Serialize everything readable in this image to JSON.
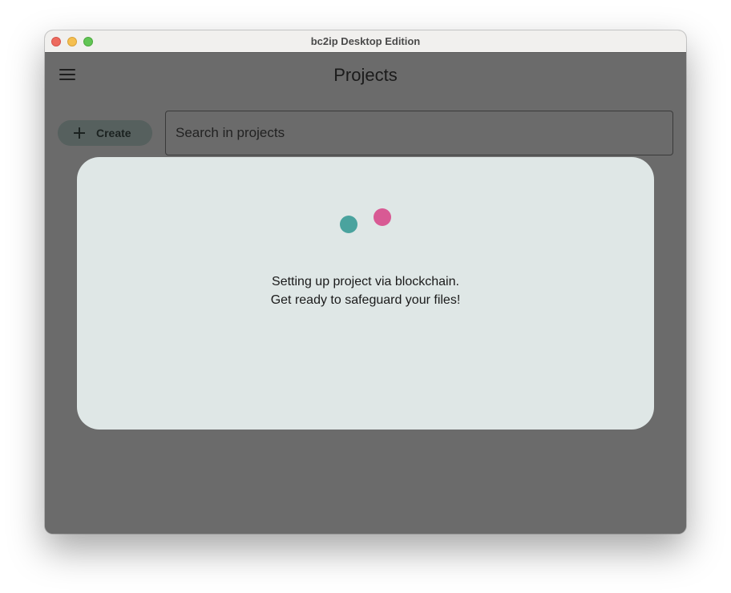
{
  "window": {
    "title": "bc2ip Desktop Edition"
  },
  "header": {
    "menu_icon": "hamburger-menu-icon",
    "title": "Projects"
  },
  "toolbar": {
    "create_icon": "plus-icon",
    "create_label": "Create"
  },
  "search": {
    "placeholder": "Search in projects",
    "value": ""
  },
  "dialog": {
    "line1": "Setting up project via blockchain.",
    "line2": "Get ready to safeguard your files!",
    "loader_colors": [
      "#4aa39e",
      "#d85a94"
    ]
  },
  "colors": {
    "overlay": "#6b6b6b",
    "dialog_bg": "#dfe7e6",
    "create_button_bg": "#56605e"
  }
}
